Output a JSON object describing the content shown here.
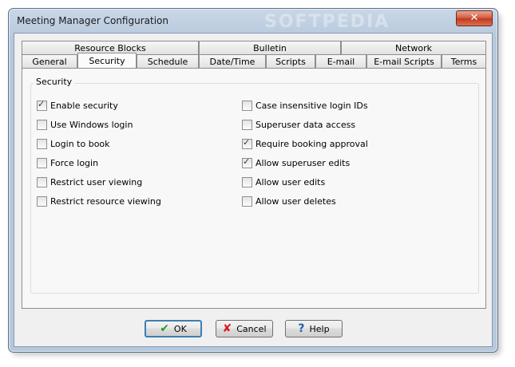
{
  "window": {
    "title": "Meeting Manager Configuration",
    "watermark": "SOFTPEDIA",
    "close_label": "✕"
  },
  "tabs": {
    "row_top": [
      "Resource Blocks",
      "Bulletin",
      "Network"
    ],
    "row_bottom": [
      "General",
      "Security",
      "Schedule",
      "Date/Time",
      "Scripts",
      "E-mail",
      "E-mail Scripts",
      "Terms"
    ],
    "active": "Security"
  },
  "security": {
    "legend": "Security",
    "left": [
      {
        "label": "Enable security",
        "checked": true
      },
      {
        "label": "Use Windows login",
        "checked": false
      },
      {
        "label": "Login to book",
        "checked": false
      },
      {
        "label": "Force login",
        "checked": false
      },
      {
        "label": "Restrict user viewing",
        "checked": false
      },
      {
        "label": "Restrict resource viewing",
        "checked": false
      }
    ],
    "right": [
      {
        "label": "Case insensitive login IDs",
        "checked": false
      },
      {
        "label": "Superuser data access",
        "checked": false
      },
      {
        "label": "Require booking approval",
        "checked": true
      },
      {
        "label": "Allow superuser edits",
        "checked": true
      },
      {
        "label": "Allow user edits",
        "checked": false
      },
      {
        "label": "Allow user deletes",
        "checked": false
      }
    ]
  },
  "buttons": {
    "ok": "OK",
    "cancel": "Cancel",
    "help": "Help"
  },
  "colors": {
    "ok_icon": "#2a9a2a",
    "cancel_icon": "#d22020",
    "help_icon": "#1f5fb0"
  }
}
